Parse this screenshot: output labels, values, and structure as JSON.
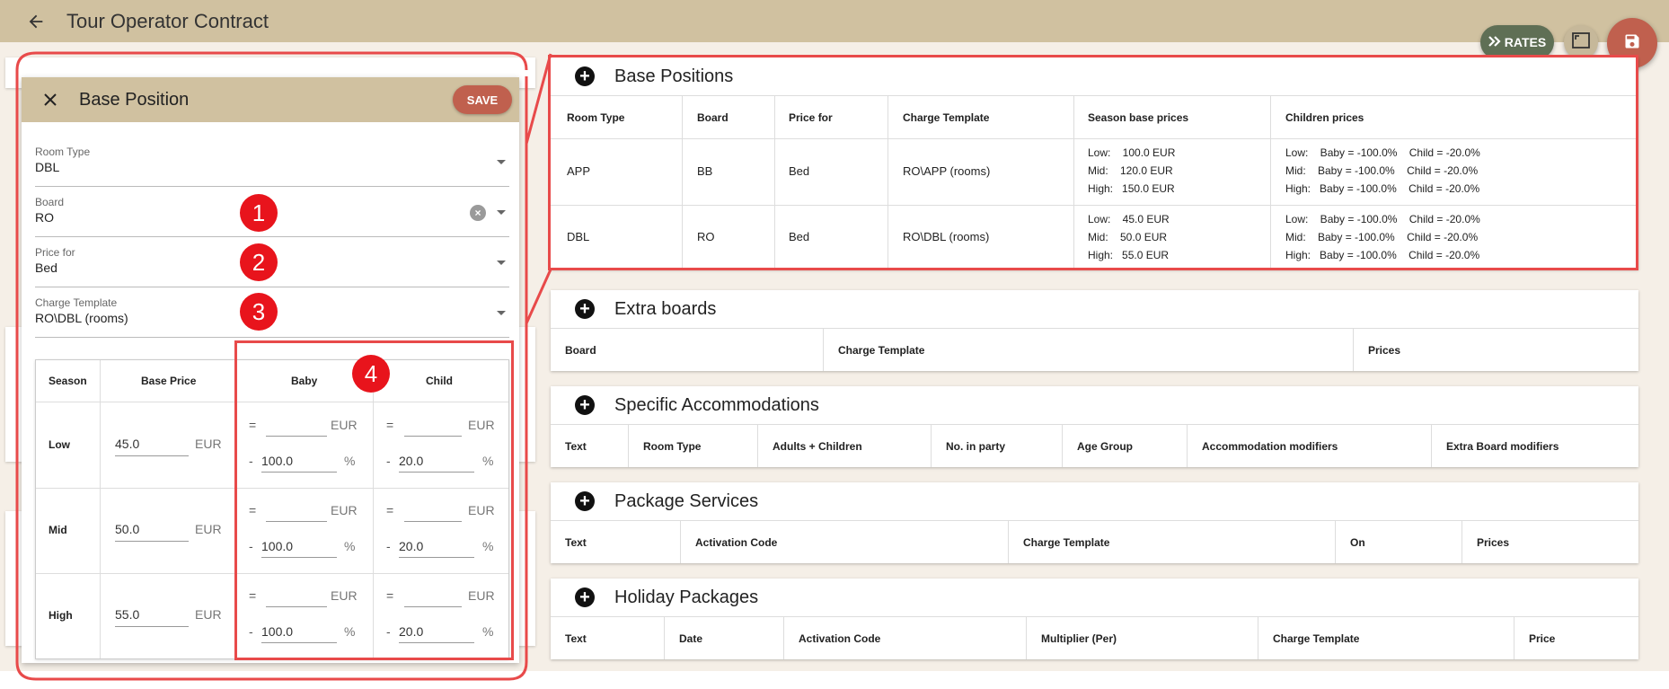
{
  "app": {
    "title": "Tour Operator Contract"
  },
  "toolbar": {
    "rates_label": "RATES"
  },
  "panel": {
    "title": "Base Position",
    "save_label": "SAVE",
    "fields": {
      "room_type": {
        "label": "Room Type",
        "value": "DBL"
      },
      "board": {
        "label": "Board",
        "value": "RO"
      },
      "price_for": {
        "label": "Price for",
        "value": "Bed"
      },
      "charge_template": {
        "label": "Charge Template",
        "value": "RO\\DBL (rooms)"
      }
    },
    "season_table": {
      "headers": {
        "season": "Season",
        "base_price": "Base Price",
        "baby": "Baby",
        "child": "Child"
      },
      "currency": "EUR",
      "percent": "%",
      "equals": "=",
      "minus": "-",
      "rows": [
        {
          "season": "Low",
          "base_price": "45.0",
          "baby_pct": "100.0",
          "child_pct": "20.0"
        },
        {
          "season": "Mid",
          "base_price": "50.0",
          "baby_pct": "100.0",
          "child_pct": "20.0"
        },
        {
          "season": "High",
          "base_price": "55.0",
          "baby_pct": "100.0",
          "child_pct": "20.0"
        }
      ]
    }
  },
  "annotations": {
    "b1": "1",
    "b2": "2",
    "b3": "3",
    "b4": "4"
  },
  "base_positions": {
    "title": "Base Positions",
    "columns": [
      "Room Type",
      "Board",
      "Price for",
      "Charge Template",
      "Season base prices",
      "Children prices"
    ],
    "rows": [
      {
        "room_type": "APP",
        "board": "BB",
        "price_for": "Bed",
        "charge_template": "RO\\APP (rooms)",
        "season_prices": "Low:    100.0 EUR\nMid:    120.0 EUR\nHigh:   150.0 EUR",
        "children_prices": "Low:    Baby = -100.0%    Child = -20.0%\nMid:    Baby = -100.0%    Child = -20.0%\nHigh:   Baby = -100.0%    Child = -20.0%"
      },
      {
        "room_type": "DBL",
        "board": "RO",
        "price_for": "Bed",
        "charge_template": "RO\\DBL (rooms)",
        "season_prices": "Low:    45.0 EUR\nMid:    50.0 EUR\nHigh:   55.0 EUR",
        "children_prices": "Low:    Baby = -100.0%    Child = -20.0%\nMid:    Baby = -100.0%    Child = -20.0%\nHigh:   Baby = -100.0%    Child = -20.0%"
      }
    ]
  },
  "extra_boards": {
    "title": "Extra boards",
    "columns": [
      "Board",
      "Charge Template",
      "Prices"
    ]
  },
  "specific_accommodations": {
    "title": "Specific Accommodations",
    "columns": [
      "Text",
      "Room Type",
      "Adults + Children",
      "No. in party",
      "Age Group",
      "Accommodation modifiers",
      "Extra Board modifiers"
    ]
  },
  "package_services": {
    "title": "Package Services",
    "columns": [
      "Text",
      "Activation Code",
      "Charge Template",
      "On",
      "Prices"
    ]
  },
  "holiday_packages": {
    "title": "Holiday Packages",
    "columns": [
      "Text",
      "Date",
      "Activation Code",
      "Multiplier (Per)",
      "Charge Template",
      "Price"
    ]
  },
  "colors": {
    "header": "#d0c1a0",
    "accent_red": "#c0604e",
    "annotation_red": "#e84a4a",
    "rates_green": "#5f6f55"
  }
}
